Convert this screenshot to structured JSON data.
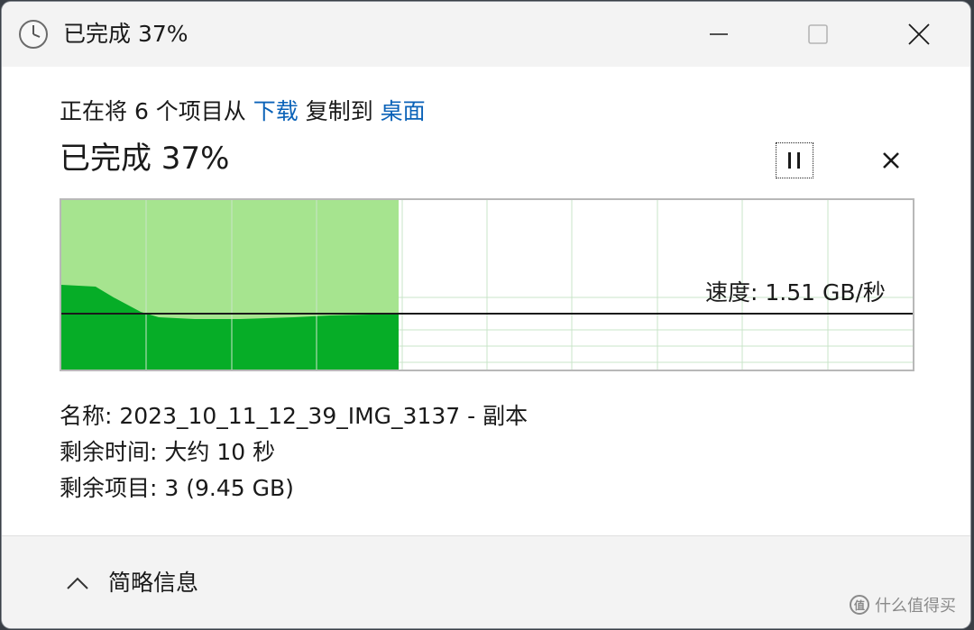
{
  "window": {
    "title": "已完成 37%"
  },
  "copy_line": {
    "prefix": "正在将 6 个项目从 ",
    "source": "下载",
    "middle": " 复制到 ",
    "destination": "桌面"
  },
  "progress": {
    "title": "已完成 37%",
    "percent": 37
  },
  "speed": {
    "label": "速度: 1.51 GB/秒"
  },
  "details": {
    "name": "名称: 2023_10_11_12_39_IMG_3137 - 副本",
    "time_remaining": "剩余时间: 大约 10 秒",
    "items_remaining": "剩余项目: 3 (9.45 GB)"
  },
  "footer": {
    "toggle_label": "简略信息"
  },
  "watermark": {
    "logo": "值",
    "text": "什么值得买"
  },
  "colors": {
    "fill_light": "#a6e48f",
    "fill_dark": "#06ad27",
    "grid": "#c9e4c9",
    "link": "#0a62b8"
  },
  "icons": {
    "title_icon": "clock-icon",
    "minimize": "minimize-icon",
    "maximize": "maximize-icon",
    "close": "close-icon",
    "pause": "pause-icon",
    "cancel": "cancel-icon",
    "toggle": "chevron-up-icon"
  }
}
